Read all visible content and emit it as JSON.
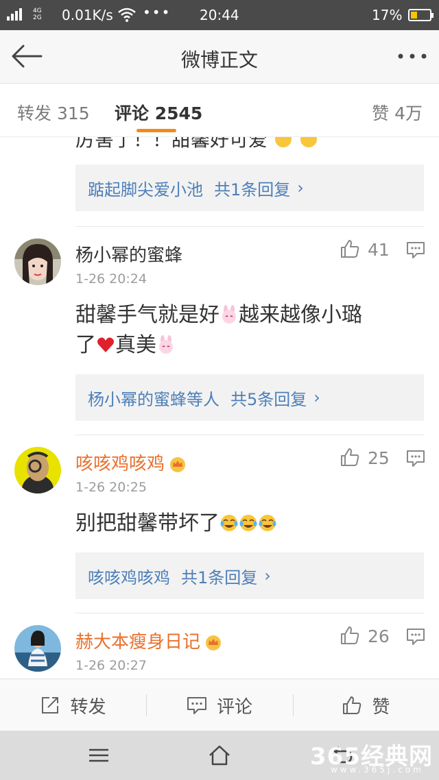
{
  "status_bar": {
    "network_top": "2G",
    "network_mid": "4G",
    "network_bottom": "2G",
    "speed": "0.01K/s",
    "more": "•••",
    "time": "20:44",
    "battery": "17%"
  },
  "header": {
    "title": "微博正文",
    "back_icon": "arrow-left-icon",
    "more_icon": "more-dots-icon"
  },
  "tabs": {
    "repost": "转发 315",
    "comments": "评论 2545",
    "likes": "赞 4万",
    "active_color": "#f08a1d"
  },
  "previous_comment": {
    "text_fragment": "厉害了！！甜馨好可爱",
    "reply_link": "踮起脚尖爱小池",
    "reply_count": "共1条回复"
  },
  "comments": [
    {
      "username": "杨小幂的蜜蜂",
      "vip": false,
      "time": "1-26 20:24",
      "text_line1": "甜馨手气就是好",
      "text_line1b": "越来越像小璐",
      "text_line2a": "了",
      "text_line2b": "真美",
      "likes": "41",
      "reply_link": "杨小幂的蜜蜂等人",
      "reply_count": "共5条回复"
    },
    {
      "username": "咳咳鸡咳鸡",
      "vip": true,
      "time": "1-26 20:25",
      "text": "别把甜馨带坏了",
      "likes": "25",
      "reply_link": "咳咳鸡咳鸡",
      "reply_count": "共1条回复"
    },
    {
      "username": "赫大本瘦身日记",
      "vip": true,
      "time": "1-26 20:27",
      "likes": "26"
    }
  ],
  "action_bar": {
    "repost": "转发",
    "comment": "评论",
    "like": "赞"
  },
  "watermark": {
    "main": "365经典网",
    "sub": "www.365j.com"
  },
  "colors": {
    "link_blue": "#4d7fb8",
    "vip_orange": "#e9702c",
    "status_bar_bg": "#4a4a4a"
  }
}
